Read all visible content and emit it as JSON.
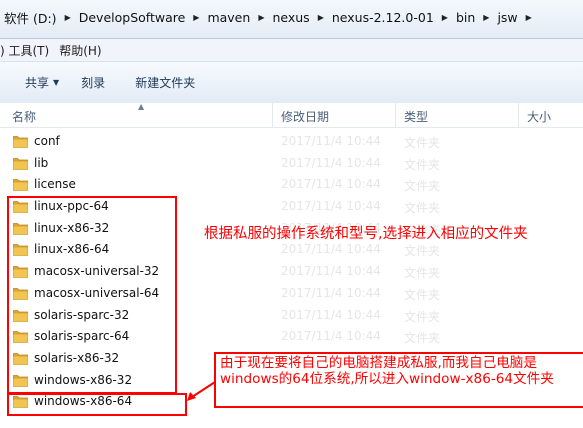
{
  "address_bar": {
    "crumbs": [
      "软件 (D:)",
      "DevelopSoftware",
      "maven",
      "nexus",
      "nexus-2.12.0-01",
      "bin",
      "jsw"
    ]
  },
  "menu": {
    "items": [
      ") 工具(T)",
      "帮助(H)"
    ]
  },
  "toolbar": {
    "share": "共享",
    "burn": "刻录",
    "new_folder": "新建文件夹"
  },
  "columns": {
    "name": "名称",
    "date": "修改日期",
    "type": "类型",
    "size": "大小"
  },
  "files": [
    {
      "name": "conf",
      "date": "2017/11/4 10:44",
      "type": "文件夹"
    },
    {
      "name": "lib",
      "date": "2017/11/4 10:44",
      "type": "文件夹"
    },
    {
      "name": "license",
      "date": "2017/11/4 10:44",
      "type": "文件夹"
    },
    {
      "name": "linux-ppc-64",
      "date": "2017/11/4 10:44",
      "type": "文件夹"
    },
    {
      "name": "linux-x86-32",
      "date": "2017/11/4 10:44",
      "type": "文件夹"
    },
    {
      "name": "linux-x86-64",
      "date": "2017/11/4 10:44",
      "type": "文件夹"
    },
    {
      "name": "macosx-universal-32",
      "date": "2017/11/4 10:44",
      "type": "文件夹"
    },
    {
      "name": "macosx-universal-64",
      "date": "2017/11/4 10:44",
      "type": "文件夹"
    },
    {
      "name": "solaris-sparc-32",
      "date": "2017/11/4 10:44",
      "type": "文件夹"
    },
    {
      "name": "solaris-sparc-64",
      "date": "2017/11/4 10:44",
      "type": "文件夹"
    },
    {
      "name": "solaris-x86-32",
      "date": "2017/11/4 10:44",
      "type": "文件夹"
    },
    {
      "name": "windows-x86-32",
      "date": "2017/11/4 10:44",
      "type": "文件夹"
    },
    {
      "name": "windows-x86-64",
      "date": "2017/11/4 10:44",
      "type": "文件夹"
    }
  ],
  "annotations": {
    "note1": "根据私服的操作系统和型号,选择进入相应的文件夹",
    "note2": "由于现在要将自己的电脑搭建成私服,而我自己电脑是windows的64位系统,所以进入window-x86-64文件夹"
  },
  "colors": {
    "annotation": "#ff0000",
    "folder": "#e8b33a"
  }
}
